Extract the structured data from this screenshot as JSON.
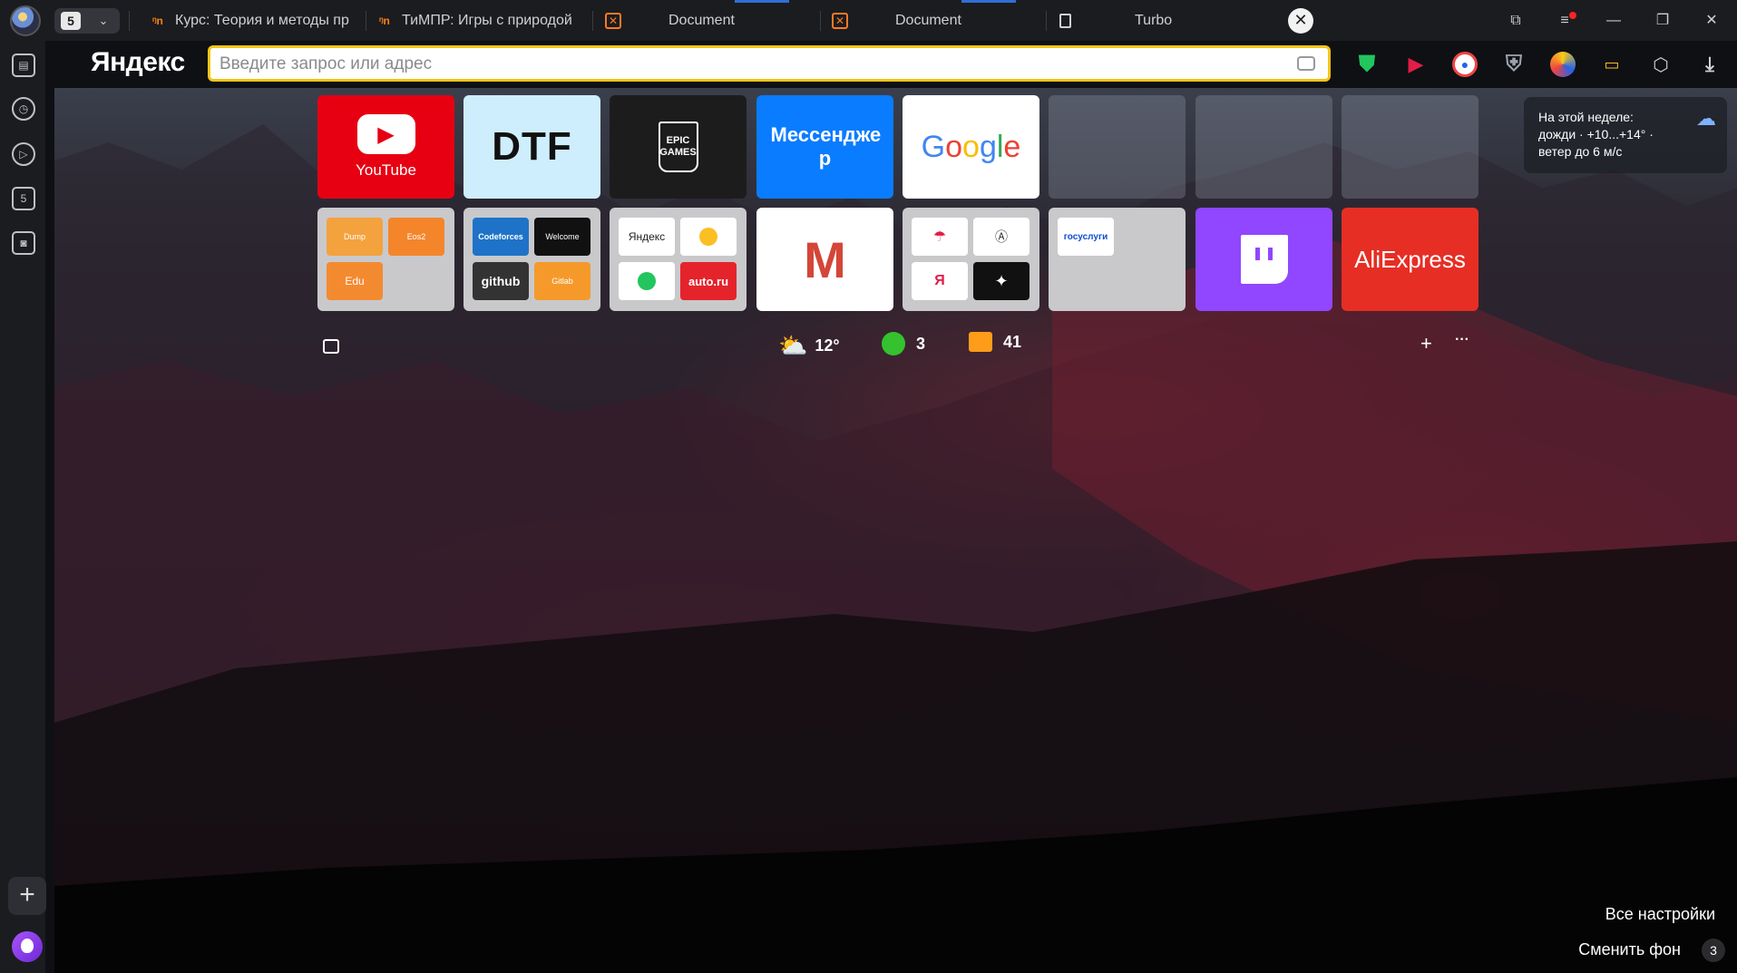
{
  "tabs": {
    "count": "5",
    "items": [
      {
        "label": "Курс: Теория и методы пр",
        "icon": "moodle-icon"
      },
      {
        "label": "ТиМПР: Игры с природой",
        "icon": "moodle-icon"
      },
      {
        "label": "Document",
        "icon": "xampp-icon"
      },
      {
        "label": "Document",
        "icon": "xampp-icon"
      },
      {
        "label": "Turbo",
        "icon": "page-icon"
      }
    ]
  },
  "browser": {
    "brand": "Яндекс",
    "address_placeholder": "Введите запрос или адрес",
    "address_value": ""
  },
  "speed_dial": {
    "row1": [
      {
        "label": "YouTube",
        "color": "#e60012"
      },
      {
        "label": "DTF",
        "color": "#cfeefd"
      },
      {
        "label": "EPIC GAMES",
        "color": "#1c1c1c"
      },
      {
        "label": "Мессендже р",
        "color": "#0a7cff"
      },
      {
        "label": "Google",
        "color": "#ffffff"
      },
      {
        "label": "",
        "color": "translucent"
      },
      {
        "label": "",
        "color": "translucent"
      },
      {
        "label": "",
        "color": "translucent"
      }
    ],
    "folder1": [
      "Dump",
      "Eos2",
      "Edu"
    ],
    "folder2": [
      "Codeforces",
      "Welcome",
      "github",
      "Gitlab"
    ],
    "folder3": [
      "Яндекс",
      "",
      "",
      "auto.ru"
    ],
    "gmail": "Gmail",
    "folder4": [
      "",
      "",
      "",
      ""
    ],
    "gosuslugi": "госуслуги",
    "twitch": "Twitch",
    "aliexpress": "AliExpress"
  },
  "weather_widget": {
    "line1": "На этой неделе:",
    "line2": "дожди · +10...+14° ·",
    "line3": "ветер до 6 м/с"
  },
  "info_bar": {
    "temperature": "12°",
    "traffic": "3",
    "mail": "41",
    "add": "+",
    "more": "···"
  },
  "footer": {
    "settings": "Все настройки",
    "change_bg": "Сменить фон",
    "bg_count": "3"
  }
}
